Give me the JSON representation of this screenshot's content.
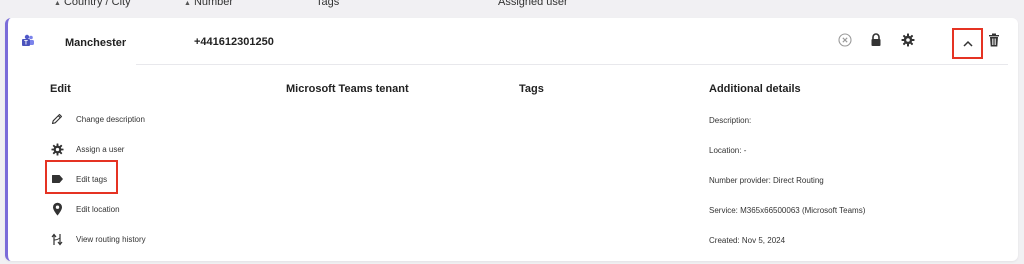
{
  "table_header": {
    "country_city": "Country / City",
    "number": "Number",
    "tags": "Tags",
    "assigned_user": "Assigned user"
  },
  "row": {
    "city": "Manchester",
    "number": "+441612301250"
  },
  "sections": {
    "edit": "Edit",
    "tenant": "Microsoft Teams tenant",
    "tags": "Tags",
    "additional": "Additional details"
  },
  "actions": [
    {
      "label": "Change description",
      "icon": "pencil-icon"
    },
    {
      "label": "Assign a user",
      "icon": "gear-icon"
    },
    {
      "label": "Edit tags",
      "icon": "tag-icon"
    },
    {
      "label": "Edit location",
      "icon": "location-pin-icon"
    },
    {
      "label": "View routing history",
      "icon": "routing-icon"
    }
  ],
  "details": {
    "description": "Description:",
    "location": "Location: -",
    "provider": "Number provider: Direct Routing",
    "service": "Service: M365x66500063 (Microsoft Teams)",
    "created": "Created: Nov 5, 2024"
  },
  "colors": {
    "accent": "#7b6cd9",
    "highlight": "#e53323"
  }
}
